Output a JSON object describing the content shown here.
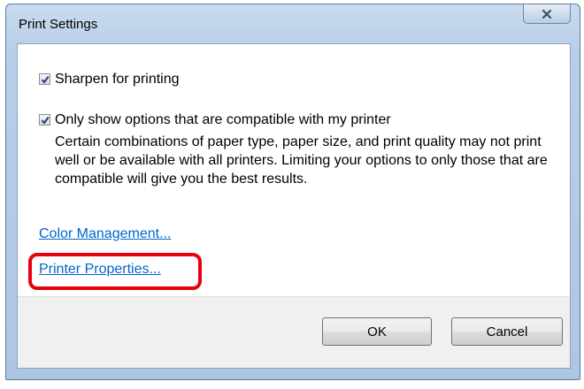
{
  "window": {
    "title": "Print Settings",
    "close_icon": "close-icon"
  },
  "options": {
    "sharpen_label": "Sharpen for printing",
    "sharpen_checked": true,
    "compatible_label": "Only show options that are compatible with my printer",
    "compatible_checked": true,
    "description": "Certain combinations of paper type, paper size, and print quality may not print well or be available with all printers.  Limiting your options to only those that are compatible will give you the best results."
  },
  "links": {
    "color_management": "Color Management...",
    "printer_properties": "Printer Properties..."
  },
  "buttons": {
    "ok": "OK",
    "cancel": "Cancel"
  },
  "colors": {
    "link": "#0066cc",
    "highlight": "#e8000f"
  }
}
